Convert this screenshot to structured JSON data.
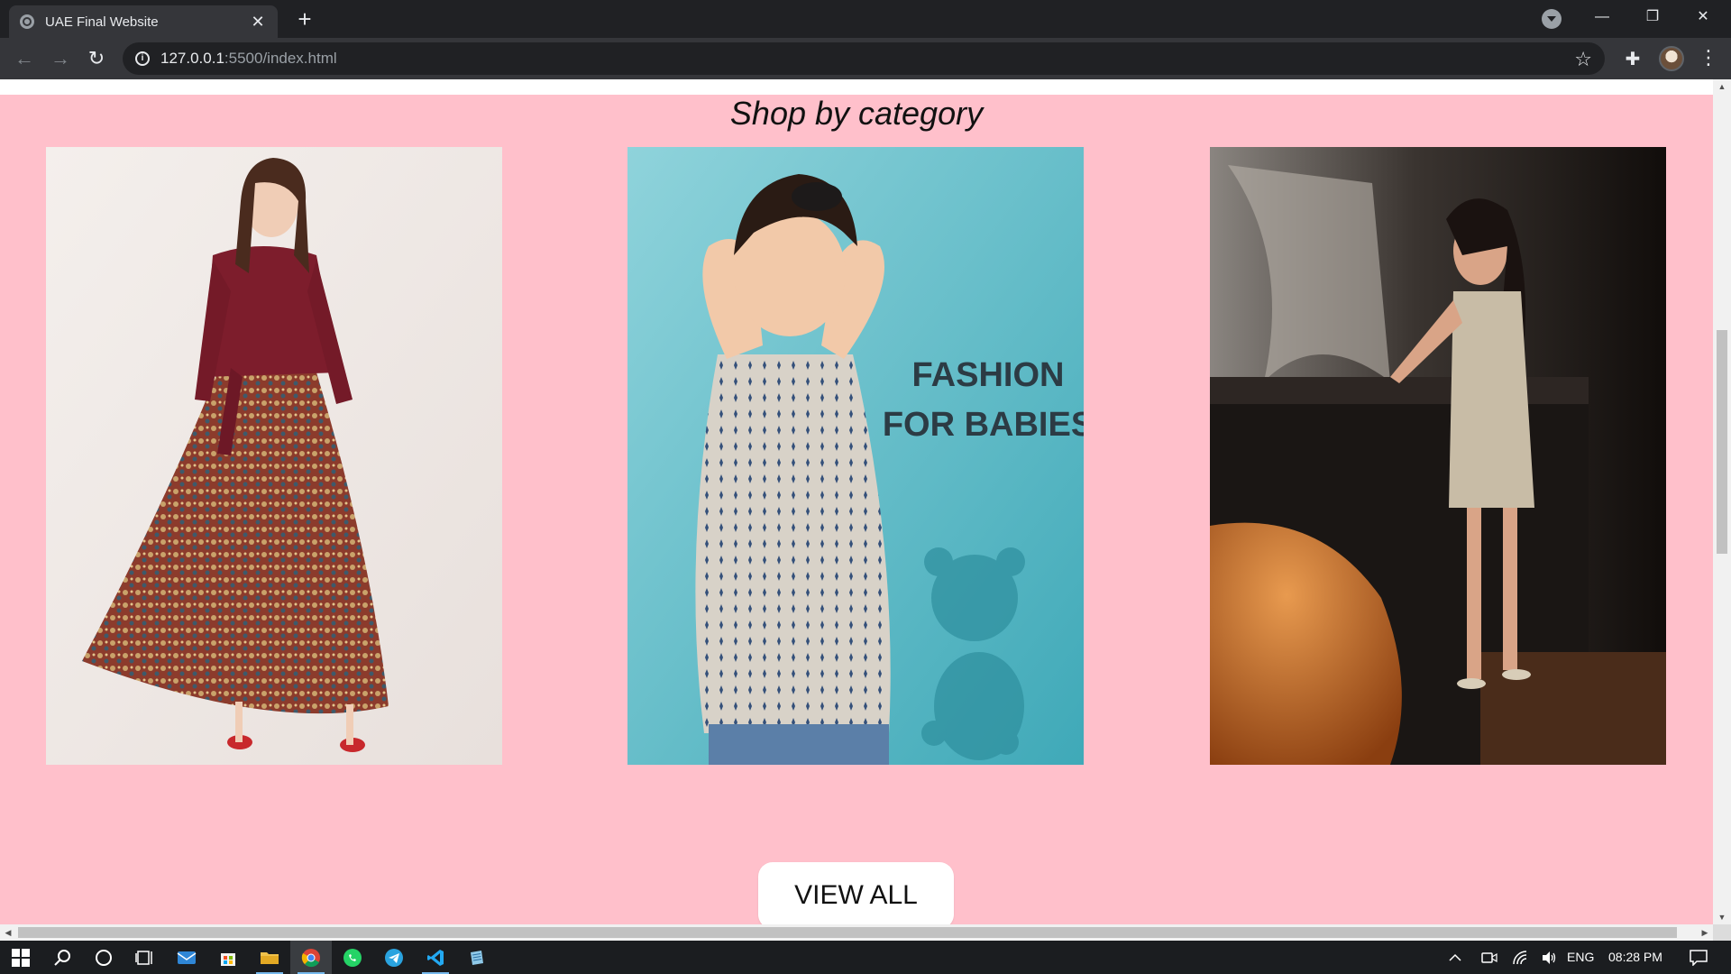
{
  "browser": {
    "tab_title": "UAE Final Website",
    "tab_close": "✕",
    "new_tab": "+",
    "url_host": "127.0.0.1",
    "url_path": ":5500/index.html",
    "window_controls": {
      "minimize": "—",
      "restore": "❐",
      "close": "✕"
    },
    "icons": {
      "back": "←",
      "forward": "→",
      "reload": "↻",
      "info": "i",
      "star": "☆",
      "extensions": "✚",
      "menu": "⋮"
    }
  },
  "page": {
    "section_title": "Shop by category",
    "cards": [
      {
        "label": "women-dress-photo",
        "overlay_text": ""
      },
      {
        "label": "baby-fashion-photo",
        "overlay_line1": "FASHION",
        "overlay_line2": "FOR BABIES"
      },
      {
        "label": "party-dress-photo",
        "overlay_text": ""
      }
    ],
    "view_all_label": "VIEW ALL"
  },
  "scrollbar": {
    "vertical_position_percent": 30
  },
  "taskbar": {
    "language": "ENG",
    "time": "08:28 PM"
  },
  "colors": {
    "section_background": "#ffc0cb",
    "chrome_dark": "#202124",
    "toolbar": "#35363a"
  }
}
